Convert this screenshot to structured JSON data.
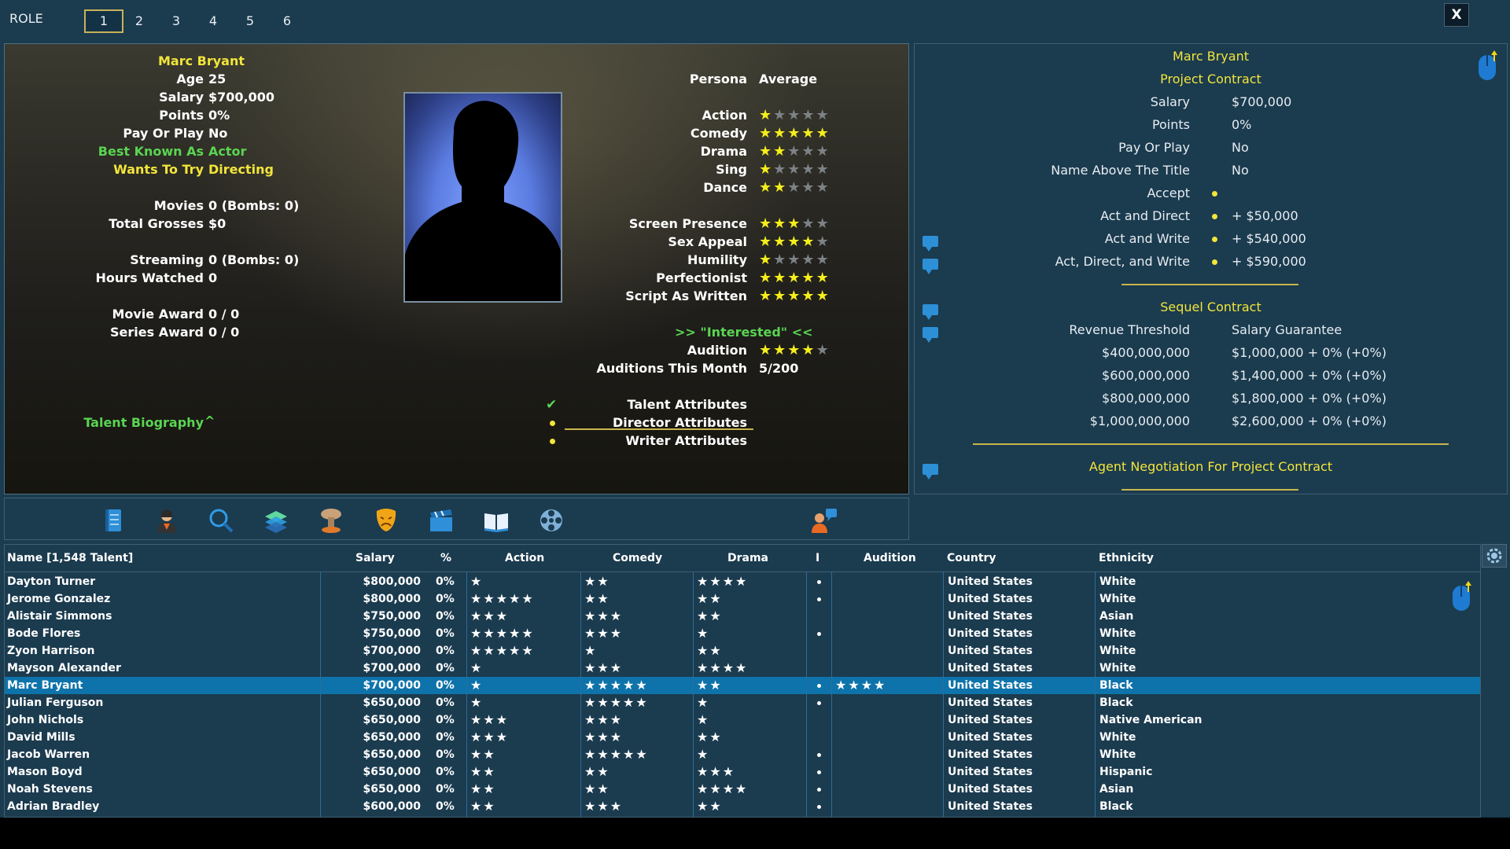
{
  "topbar": {
    "role_label": "ROLE",
    "role_tabs": [
      "1",
      "2",
      "3",
      "4",
      "5",
      "6"
    ],
    "active_tab": "1",
    "close_label": "X"
  },
  "talent": {
    "name": "Marc Bryant",
    "left_fields": [
      {
        "label": "Age",
        "value": "25"
      },
      {
        "label": "Salary",
        "value": "$700,000"
      },
      {
        "label": "Points",
        "value": "0%"
      },
      {
        "label": "Pay Or Play",
        "value": "No"
      },
      {
        "label": "Best Known As",
        "value": "Actor"
      },
      {
        "label": "Wants To Try",
        "value": "Directing"
      },
      {
        "label": "Movies",
        "value": "0 (Bombs: 0)"
      },
      {
        "label": "Total Grosses",
        "value": "$0"
      },
      {
        "label": "Streaming",
        "value": "0 (Bombs: 0)"
      },
      {
        "label": "Hours Watched",
        "value": "0"
      },
      {
        "label": "Movie Award",
        "value": "0 / 0"
      },
      {
        "label": "Series Award",
        "value": "0 / 0"
      }
    ],
    "biography_label": "Talent Biography",
    "biography_caret": "^",
    "persona_label": "Persona",
    "persona_value": "Average",
    "ratings": [
      {
        "label": "Action",
        "value": 1
      },
      {
        "label": "Comedy",
        "value": 5
      },
      {
        "label": "Drama",
        "value": 2
      },
      {
        "label": "Sing",
        "value": 1
      },
      {
        "label": "Dance",
        "value": 2
      },
      {
        "label": "Screen Presence",
        "value": 3
      },
      {
        "label": "Sex Appeal",
        "value": 4
      },
      {
        "label": "Humility",
        "value": 1
      },
      {
        "label": "Perfectionist",
        "value": 5
      },
      {
        "label": "Script As Written",
        "value": 5
      }
    ],
    "interest_text": ">>  \"Interested\"  <<",
    "audition_label": "Audition",
    "audition_value": 4,
    "auditions_month_label": "Auditions This Month",
    "auditions_month_value": "5/200",
    "attribute_links": [
      {
        "label": "Talent Attributes",
        "marker": "check"
      },
      {
        "label": "Director Attributes",
        "marker": "dot"
      },
      {
        "label": "Writer Attributes",
        "marker": "dot"
      }
    ]
  },
  "contract": {
    "name": "Marc Bryant",
    "project_title": "Project Contract",
    "fields": [
      {
        "label": "Salary",
        "value": "$700,000"
      },
      {
        "label": "Points",
        "value": "0%"
      },
      {
        "label": "Pay Or Play",
        "value": "No"
      },
      {
        "label": "Name Above The Title",
        "value": "No"
      },
      {
        "label": "Accept",
        "value": ""
      },
      {
        "label": "Act and Direct",
        "value": "+ $50,000"
      },
      {
        "label": "Act and Write",
        "value": "+ $540,000"
      },
      {
        "label": "Act, Direct, and Write",
        "value": "+ $590,000"
      }
    ],
    "sequel_title": "Sequel Contract",
    "sequel_header_left": "Revenue Threshold",
    "sequel_header_right": "Salary Guarantee",
    "sequel_rows": [
      {
        "threshold": "$400,000,000",
        "guarantee": "$1,000,000 + 0%  (+0%)"
      },
      {
        "threshold": "$600,000,000",
        "guarantee": "$1,400,000 + 0%  (+0%)"
      },
      {
        "threshold": "$800,000,000",
        "guarantee": "$1,800,000 + 0%  (+0%)"
      },
      {
        "threshold": "$1,000,000,000",
        "guarantee": "$2,600,000 + 0%  (+0%)"
      }
    ],
    "agent_label": "Agent Negotiation For Project Contract"
  },
  "toolbar": {
    "tools": [
      "notebook-icon",
      "person-icon",
      "magnifier-icon",
      "layers-icon",
      "explosion-icon",
      "drama-mask-icon",
      "clapperboard-icon",
      "open-book-icon",
      "film-reel-icon",
      "talk-icon"
    ]
  },
  "table": {
    "headers": {
      "name": "Name [1,548 Talent]",
      "salary": "Salary",
      "pct": "%",
      "action": "Action",
      "comedy": "Comedy",
      "drama": "Drama",
      "i": "I",
      "audition": "Audition",
      "country": "Country",
      "ethnicity": "Ethnicity"
    },
    "selected_index": 6,
    "rows": [
      {
        "name": "Dayton Turner",
        "salary": "$800,000",
        "pct": "0%",
        "action": 1,
        "comedy": 2,
        "drama": 4,
        "i": true,
        "audition": 0,
        "country": "United States",
        "ethnicity": "White"
      },
      {
        "name": "Jerome Gonzalez",
        "salary": "$800,000",
        "pct": "0%",
        "action": 5,
        "comedy": 2,
        "drama": 2,
        "i": true,
        "audition": 0,
        "country": "United States",
        "ethnicity": "White"
      },
      {
        "name": "Alistair Simmons",
        "salary": "$750,000",
        "pct": "0%",
        "action": 3,
        "comedy": 3,
        "drama": 2,
        "i": false,
        "audition": 0,
        "country": "United States",
        "ethnicity": "Asian"
      },
      {
        "name": "Bode Flores",
        "salary": "$750,000",
        "pct": "0%",
        "action": 5,
        "comedy": 3,
        "drama": 1,
        "i": true,
        "audition": 0,
        "country": "United States",
        "ethnicity": "White"
      },
      {
        "name": "Zyon Harrison",
        "salary": "$700,000",
        "pct": "0%",
        "action": 5,
        "comedy": 1,
        "drama": 2,
        "i": false,
        "audition": 0,
        "country": "United States",
        "ethnicity": "White"
      },
      {
        "name": "Mayson Alexander",
        "salary": "$700,000",
        "pct": "0%",
        "action": 1,
        "comedy": 3,
        "drama": 4,
        "i": false,
        "audition": 0,
        "country": "United States",
        "ethnicity": "White"
      },
      {
        "name": "Marc Bryant",
        "salary": "$700,000",
        "pct": "0%",
        "action": 1,
        "comedy": 5,
        "drama": 2,
        "i": true,
        "audition": 4,
        "country": "United States",
        "ethnicity": "Black"
      },
      {
        "name": "Julian Ferguson",
        "salary": "$650,000",
        "pct": "0%",
        "action": 1,
        "comedy": 5,
        "drama": 1,
        "i": true,
        "audition": 0,
        "country": "United States",
        "ethnicity": "Black"
      },
      {
        "name": "John Nichols",
        "salary": "$650,000",
        "pct": "0%",
        "action": 3,
        "comedy": 3,
        "drama": 1,
        "i": false,
        "audition": 0,
        "country": "United States",
        "ethnicity": "Native American"
      },
      {
        "name": "David Mills",
        "salary": "$650,000",
        "pct": "0%",
        "action": 3,
        "comedy": 3,
        "drama": 2,
        "i": false,
        "audition": 0,
        "country": "United States",
        "ethnicity": "White"
      },
      {
        "name": "Jacob Warren",
        "salary": "$650,000",
        "pct": "0%",
        "action": 2,
        "comedy": 5,
        "drama": 1,
        "i": true,
        "audition": 0,
        "country": "United States",
        "ethnicity": "White"
      },
      {
        "name": "Mason Boyd",
        "salary": "$650,000",
        "pct": "0%",
        "action": 2,
        "comedy": 2,
        "drama": 3,
        "i": true,
        "audition": 0,
        "country": "United States",
        "ethnicity": "Hispanic"
      },
      {
        "name": "Noah Stevens",
        "salary": "$650,000",
        "pct": "0%",
        "action": 2,
        "comedy": 2,
        "drama": 4,
        "i": true,
        "audition": 0,
        "country": "United States",
        "ethnicity": "Asian"
      },
      {
        "name": "Adrian Bradley",
        "salary": "$600,000",
        "pct": "0%",
        "action": 2,
        "comedy": 3,
        "drama": 2,
        "i": true,
        "audition": 0,
        "country": "United States",
        "ethnicity": "Black"
      }
    ]
  },
  "colors": {
    "background": "#1b3b4f",
    "highlight_yellow": "#f2e53a",
    "highlight_green": "#5ad552",
    "selected_row": "#0e73aa",
    "star_on": "#f5ee1c",
    "star_off": "#7d8286"
  }
}
